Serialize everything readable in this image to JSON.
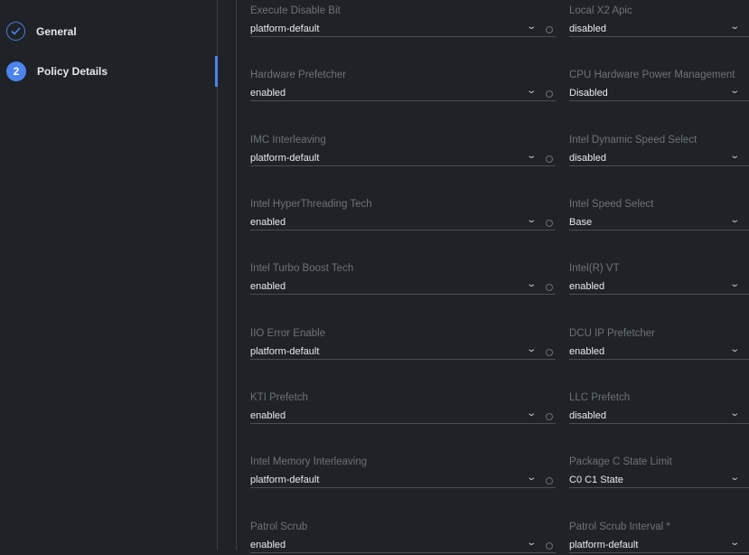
{
  "steps": [
    {
      "label": "General",
      "state": "completed",
      "icon": "check-icon"
    },
    {
      "label": "Policy Details",
      "number": "2",
      "state": "active"
    }
  ],
  "colors": {
    "accent": "#4c84ee",
    "background": "#1f2226"
  },
  "fields": [
    {
      "left": {
        "label": "Execute Disable Bit",
        "value": "platform-default"
      },
      "right": {
        "label": "Local X2 Apic",
        "value": "disabled"
      }
    },
    {
      "left": {
        "label": "Hardware Prefetcher",
        "value": "enabled"
      },
      "right": {
        "label": "CPU Hardware Power Management",
        "value": "Disabled"
      }
    },
    {
      "left": {
        "label": "IMC Interleaving",
        "value": "platform-default"
      },
      "right": {
        "label": "Intel Dynamic Speed Select",
        "value": "disabled"
      }
    },
    {
      "left": {
        "label": "Intel HyperThreading Tech",
        "value": "enabled"
      },
      "right": {
        "label": "Intel Speed Select",
        "value": "Base"
      }
    },
    {
      "left": {
        "label": "Intel Turbo Boost Tech",
        "value": "enabled"
      },
      "right": {
        "label": "Intel(R) VT",
        "value": "enabled"
      }
    },
    {
      "left": {
        "label": "IIO Error Enable",
        "value": "platform-default"
      },
      "right": {
        "label": "DCU IP Prefetcher",
        "value": "enabled"
      }
    },
    {
      "left": {
        "label": "KTI Prefetch",
        "value": "enabled"
      },
      "right": {
        "label": "LLC Prefetch",
        "value": "disabled"
      }
    },
    {
      "left": {
        "label": "Intel Memory Interleaving",
        "value": "platform-default"
      },
      "right": {
        "label": "Package C State Limit",
        "value": "C0 C1 State"
      }
    },
    {
      "left": {
        "label": "Patrol Scrub",
        "value": "enabled"
      },
      "right": {
        "label": "Patrol Scrub Interval *",
        "value": "platform-default"
      }
    }
  ]
}
